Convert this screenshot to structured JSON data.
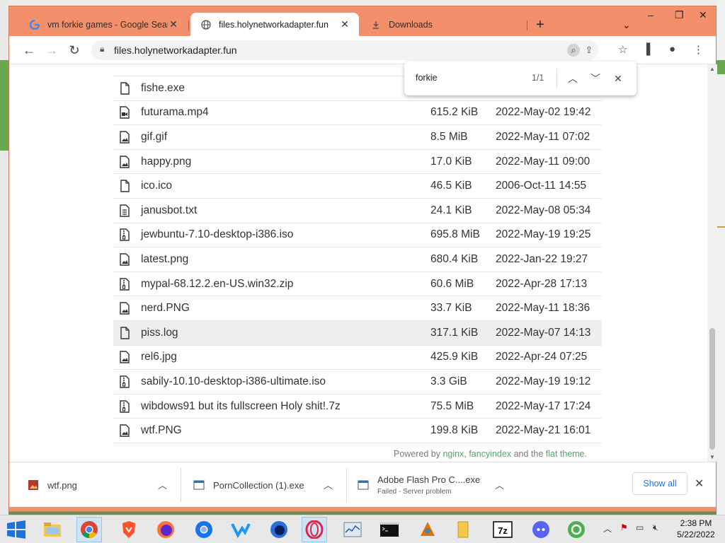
{
  "tabs": [
    {
      "title": "vm forkie games - Google Search",
      "icon": "google-icon"
    },
    {
      "title": "files.holynetworkadapter.fun",
      "icon": "globe-icon",
      "active": true
    },
    {
      "title": "Downloads",
      "icon": "download-icon"
    }
  ],
  "address_bar": {
    "url": "files.holynetworkadapter.fun"
  },
  "find_bar": {
    "query": "forkie",
    "count": "1/1"
  },
  "files": [
    {
      "name": "fishe.exe",
      "size": "",
      "date": "",
      "icon": "file-icon"
    },
    {
      "name": "futurama.mp4",
      "size": "615.2 KiB",
      "date": "2022-May-02 19:42",
      "icon": "video-file-icon"
    },
    {
      "name": "gif.gif",
      "size": "8.5 MiB",
      "date": "2022-May-11 07:02",
      "icon": "image-file-icon"
    },
    {
      "name": "happy.png",
      "size": "17.0 KiB",
      "date": "2022-May-11 09:00",
      "icon": "image-file-icon"
    },
    {
      "name": "ico.ico",
      "size": "46.5 KiB",
      "date": "2006-Oct-11 14:55",
      "icon": "file-icon"
    },
    {
      "name": "janusbot.txt",
      "size": "24.1 KiB",
      "date": "2022-May-08 05:34",
      "icon": "text-file-icon"
    },
    {
      "name": "jewbuntu-7.10-desktop-i386.iso",
      "size": "695.8 MiB",
      "date": "2022-May-19 19:25",
      "icon": "archive-file-icon"
    },
    {
      "name": "latest.png",
      "size": "680.4 KiB",
      "date": "2022-Jan-22 19:27",
      "icon": "image-file-icon"
    },
    {
      "name": "mypal-68.12.2.en-US.win32.zip",
      "size": "60.6 MiB",
      "date": "2022-Apr-28 17:13",
      "icon": "archive-file-icon"
    },
    {
      "name": "nerd.PNG",
      "size": "33.7 KiB",
      "date": "2022-May-11 18:36",
      "icon": "image-file-icon"
    },
    {
      "name": "piss.log",
      "size": "317.1 KiB",
      "date": "2022-May-07 14:13",
      "icon": "file-icon",
      "highlighted": true
    },
    {
      "name": "rel6.jpg",
      "size": "425.9 KiB",
      "date": "2022-Apr-24 07:25",
      "icon": "image-file-icon"
    },
    {
      "name": "sabily-10.10-desktop-i386-ultimate.iso",
      "size": "3.3 GiB",
      "date": "2022-May-19 19:12",
      "icon": "archive-file-icon"
    },
    {
      "name": "wibdows91 but its fullscreen Holy shit!.7z",
      "size": "75.5 MiB",
      "date": "2022-May-17 17:24",
      "icon": "archive-file-icon"
    },
    {
      "name": "wtf.PNG",
      "size": "199.8 KiB",
      "date": "2022-May-21 16:01",
      "icon": "image-file-icon"
    }
  ],
  "footer": {
    "prefix": "Powered by ",
    "nginx": "nginx",
    "comma": ", ",
    "fancyindex": "fancyindex",
    "and_the": " and the ",
    "theme": "flat theme",
    "dot": "."
  },
  "downloads": [
    {
      "name": "wtf.png",
      "status": "",
      "icon": "image-file-icon"
    },
    {
      "name": "PornCollection (1).exe",
      "status": "",
      "icon": "exe-file-icon"
    },
    {
      "name": "Adobe Flash Pro C....exe",
      "status": "Failed - Server problem",
      "icon": "exe-file-icon"
    }
  ],
  "download_shelf": {
    "show_all": "Show all"
  },
  "taskbar": {
    "apps": [
      "file-explorer-icon",
      "chrome-icon",
      "brave-icon",
      "firefox-icon",
      "chromium-icon",
      "app-icon",
      "firefox-nightly-icon",
      "opera-icon",
      "task-manager-icon",
      "cmd-icon",
      "java-icon",
      "folder-icon",
      "7zip-icon",
      "discord-icon",
      "bittorrent-icon"
    ],
    "time": "2:38 PM",
    "date": "5/22/2022"
  },
  "colors": {
    "titlebar": "#f38f6a",
    "link": "#4ca86b",
    "accent": "#1a73e8"
  }
}
